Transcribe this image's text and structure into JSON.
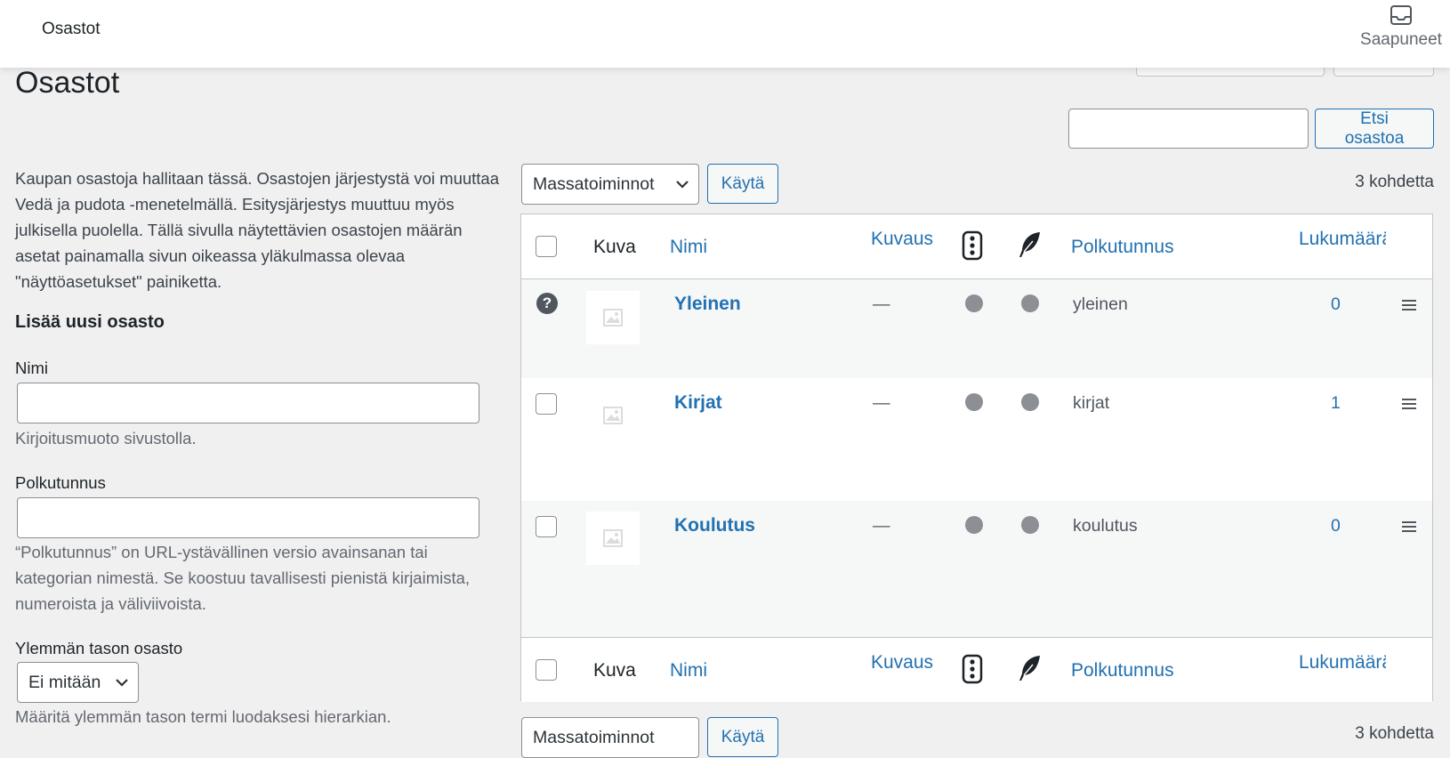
{
  "topbar": {
    "title": "Osastot",
    "inbox_label": "Saapuneet"
  },
  "page": {
    "title": "Osastot"
  },
  "search": {
    "placeholder": "",
    "button": "Etsi osastoa"
  },
  "left": {
    "description": "Kaupan osastoja hallitaan tässä. Osastojen järjestystä voi muuttaa Vedä ja pudota -menetelmällä. Esitysjärjestys muuttuu myös julkisella puolella. Tällä sivulla näytettävien osastojen määrän asetat painamalla sivun oikeassa yläkulmassa olevaa \"näyttöasetukset\" painiketta.",
    "form_heading": "Lisää uusi osasto",
    "name_label": "Nimi",
    "name_help": "Kirjoitusmuoto sivustolla.",
    "slug_label": "Polkutunnus",
    "slug_help": "“Polkutunnus” on URL-ystävällinen versio avainsanan tai kategorian nimestä. Se koostuu tavallisesti pienistä kirjaimista, numeroista ja väliviivoista.",
    "parent_label": "Ylemmän tason osasto",
    "parent_value": "Ei mitään",
    "parent_help": "Määritä ylemmän tason termi luodaksesi hierarkian."
  },
  "bulk": {
    "select": "Massatoiminnot",
    "apply": "Käytä",
    "count": "3 kohdetta"
  },
  "table": {
    "columns": {
      "image": "Kuva",
      "name": "Nimi",
      "description": "Kuvaus",
      "slug": "Polkutunnus",
      "count": "Lukumäärä"
    },
    "rows": [
      {
        "name": "Yleinen",
        "description": "—",
        "slug": "yleinen",
        "count": "0"
      },
      {
        "name": "Kirjat",
        "description": "—",
        "slug": "kirjat",
        "count": "1"
      },
      {
        "name": "Koulutus",
        "description": "—",
        "slug": "koulutus",
        "count": "0"
      }
    ]
  },
  "icons": {
    "inbox": "inbox-icon",
    "help": "question-circle-icon",
    "traffic": "traffic-light-icon",
    "feather": "feather-icon",
    "image": "image-placeholder-icon",
    "drag": "drag-handle-icon",
    "chevron": "chevron-down-icon"
  },
  "colors": {
    "link": "#2271b1",
    "text": "#1d2327",
    "muted": "#646970",
    "background": "#f0f0f1"
  }
}
